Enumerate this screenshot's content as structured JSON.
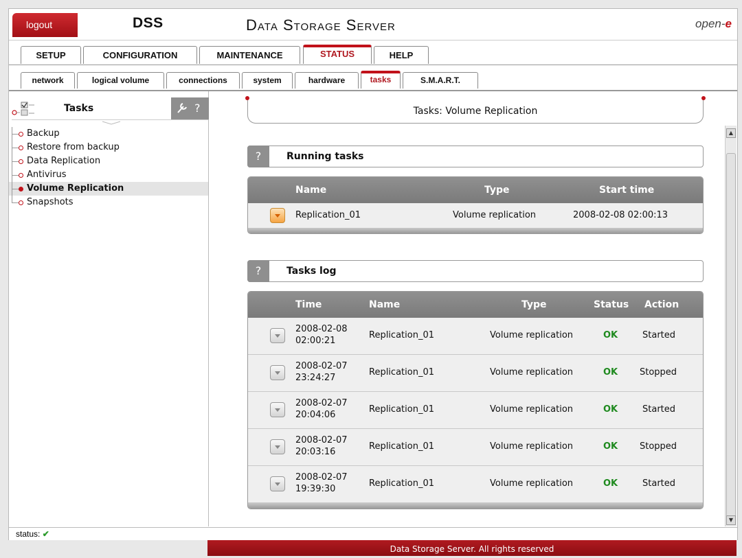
{
  "header": {
    "logout_label": "logout",
    "product_short": "DSS",
    "product_title": "Data Storage Server",
    "brand_prefix": "open-",
    "brand_suffix": "e"
  },
  "main_tabs": [
    {
      "label": "SETUP",
      "active": false
    },
    {
      "label": "CONFIGURATION",
      "active": false
    },
    {
      "label": "MAINTENANCE",
      "active": false
    },
    {
      "label": "STATUS",
      "active": true
    },
    {
      "label": "HELP",
      "active": false
    }
  ],
  "sub_tabs": [
    {
      "label": "network",
      "active": false
    },
    {
      "label": "logical volume",
      "active": false
    },
    {
      "label": "connections",
      "active": false
    },
    {
      "label": "system",
      "active": false
    },
    {
      "label": "hardware",
      "active": false
    },
    {
      "label": "tasks",
      "active": true
    },
    {
      "label": "S.M.A.R.T.",
      "active": false
    }
  ],
  "sidebar": {
    "title": "Tasks",
    "tools_icon": "wrench-icon",
    "help_label": "?",
    "items": [
      {
        "label": "Backup",
        "selected": false
      },
      {
        "label": "Restore from backup",
        "selected": false
      },
      {
        "label": "Data Replication",
        "selected": false
      },
      {
        "label": "Antivirus",
        "selected": false
      },
      {
        "label": "Volume Replication",
        "selected": true
      },
      {
        "label": "Snapshots",
        "selected": false
      }
    ]
  },
  "page_title": "Tasks: Volume Replication",
  "running": {
    "help_label": "?",
    "title": "Running tasks",
    "columns": [
      "Name",
      "Type",
      "Start time"
    ],
    "rows": [
      {
        "name": "Replication_01",
        "type": "Volume replication",
        "start": "2008-02-08 02:00:13"
      }
    ]
  },
  "log": {
    "help_label": "?",
    "title": "Tasks log",
    "columns": [
      "Time",
      "Name",
      "Type",
      "Status",
      "Action"
    ],
    "rows": [
      {
        "date": "2008-02-08",
        "time": "02:00:21",
        "name": "Replication_01",
        "type": "Volume replication",
        "status": "OK",
        "action": "Started"
      },
      {
        "date": "2008-02-07",
        "time": "23:24:27",
        "name": "Replication_01",
        "type": "Volume replication",
        "status": "OK",
        "action": "Stopped"
      },
      {
        "date": "2008-02-07",
        "time": "20:04:06",
        "name": "Replication_01",
        "type": "Volume replication",
        "status": "OK",
        "action": "Started"
      },
      {
        "date": "2008-02-07",
        "time": "20:03:16",
        "name": "Replication_01",
        "type": "Volume replication",
        "status": "OK",
        "action": "Stopped"
      },
      {
        "date": "2008-02-07",
        "time": "19:39:30",
        "name": "Replication_01",
        "type": "Volume replication",
        "status": "OK",
        "action": "Started"
      }
    ]
  },
  "statusbar": {
    "label": "status:",
    "icon": "checkmark-icon",
    "check": "✔"
  },
  "footer": "Data Storage Server. All rights reserved",
  "colors": {
    "brand_red": "#c1121a",
    "ok_green": "#1f8a1f",
    "header_gray": "#8a8a8a"
  }
}
